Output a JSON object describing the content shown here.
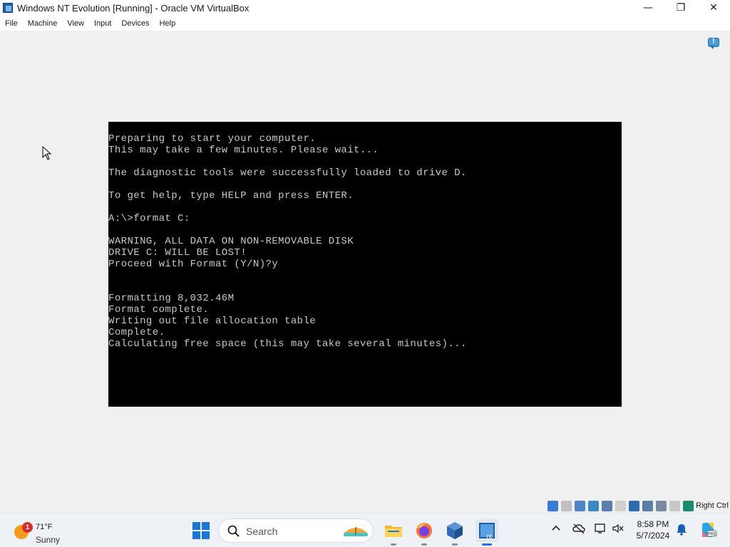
{
  "window": {
    "title": "Windows NT Evolution [Running] - Oracle VM VirtualBox",
    "controls": {
      "minimize": "—",
      "maximize": "❐",
      "close": "✕"
    }
  },
  "menubar": {
    "items": [
      "File",
      "Machine",
      "View",
      "Input",
      "Devices",
      "Help"
    ]
  },
  "console": {
    "lines": [
      "Preparing to start your computer.",
      "This may take a few minutes. Please wait...",
      "",
      "The diagnostic tools were successfully loaded to drive D.",
      "",
      "To get help, type HELP and press ENTER.",
      "",
      "A:\\>format C:",
      "",
      "WARNING, ALL DATA ON NON-REMOVABLE DISK",
      "DRIVE C: WILL BE LOST!",
      "Proceed with Format (Y/N)?y",
      "",
      "",
      "Formatting 8,032.46M",
      "Format complete.",
      "Writing out file allocation table",
      "Complete.",
      "Calculating free space (this may take several minutes)..."
    ]
  },
  "statusbar": {
    "icons": [
      {
        "name": "hard-disk-icon",
        "color": "#3a7bd5"
      },
      {
        "name": "optical-drive-icon",
        "color": "#c0c0c0"
      },
      {
        "name": "audio-icon",
        "color": "#4b86c8"
      },
      {
        "name": "network-icon",
        "color": "#3b8ac4"
      },
      {
        "name": "usb-icon",
        "color": "#5a7fae"
      },
      {
        "name": "shared-folders-icon",
        "color": "#d0d0d0"
      },
      {
        "name": "display-icon",
        "color": "#2f6bb0"
      },
      {
        "name": "video-capture-icon",
        "color": "#5b7ea6"
      },
      {
        "name": "virtualization-icon",
        "color": "#7a8aa0"
      },
      {
        "name": "mouse-integration-icon",
        "color": "#c8c8c8"
      },
      {
        "name": "keyboard-icon",
        "color": "#1c8a6f"
      }
    ],
    "host_key": "Right Ctrl"
  },
  "taskbar": {
    "weather": {
      "badge": "1",
      "temp": "71°F",
      "condition": "Sunny"
    },
    "search_label": "Search",
    "clock": {
      "time": "8:58 PM",
      "date": "5/7/2024"
    },
    "apps": [
      {
        "name": "file-explorer-icon"
      },
      {
        "name": "firefox-icon"
      },
      {
        "name": "virtualbox-icon"
      },
      {
        "name": "windows-nt-vm-icon"
      }
    ],
    "tray": [
      {
        "name": "show-hidden-icons-chevron"
      },
      {
        "name": "onedrive-icon"
      },
      {
        "name": "network-status-icon"
      },
      {
        "name": "volume-icon"
      },
      {
        "name": "notification-bell-icon"
      },
      {
        "name": "copilot-icon"
      }
    ]
  }
}
